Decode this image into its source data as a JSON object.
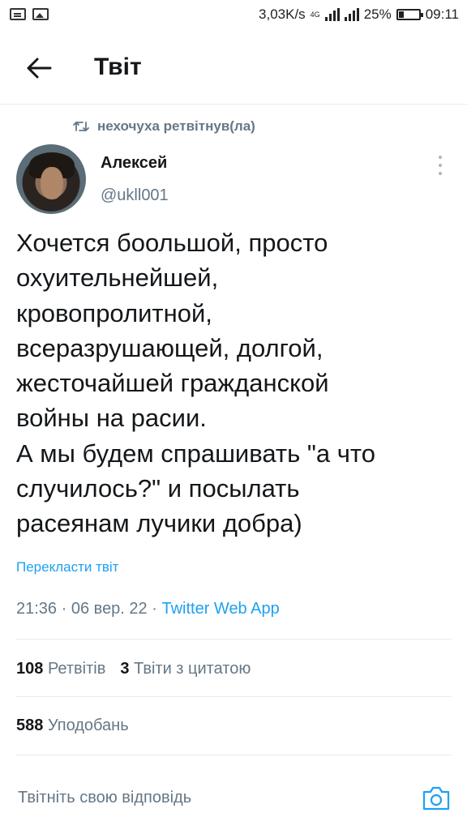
{
  "status_bar": {
    "speed": "3,03K/s",
    "network": "4G",
    "battery_percent": "25%",
    "battery_level": 0.25,
    "time": "09:11"
  },
  "header": {
    "title": "Твіт"
  },
  "retweet": {
    "label": "нехочуха ретвітнув(ла)"
  },
  "tweet": {
    "author_name": "Алексей",
    "author_handle": "@ukll001",
    "text": "Хочется боольшой, просто\nохуительнейшей,\nкровопролитной,\nвсеразрушающей, долгой,\nжесточайшей гражданской\nвойны на расии.\nА мы будем спрашивать \"а что\nслучилось?\" и посылать\nрасеянам лучики добра)",
    "translate_label": "Перекласти твіт",
    "time": "21:36",
    "date": "06 вер. 22",
    "source": "Twitter Web App",
    "separator": "·"
  },
  "stats": {
    "retweets_count": "108",
    "retweets_label": "Ретвітів",
    "quotes_count": "3",
    "quotes_label": "Твіти з цитатою",
    "likes_count": "588",
    "likes_label": "Уподобань"
  },
  "reply": {
    "placeholder": "Твітніть свою відповідь"
  },
  "colors": {
    "accent": "#1da1f2",
    "muted": "#657786",
    "divider": "#e6ecf0"
  },
  "icons": [
    "back-arrow-icon",
    "retweet-icon",
    "more-icon",
    "camera-icon"
  ]
}
